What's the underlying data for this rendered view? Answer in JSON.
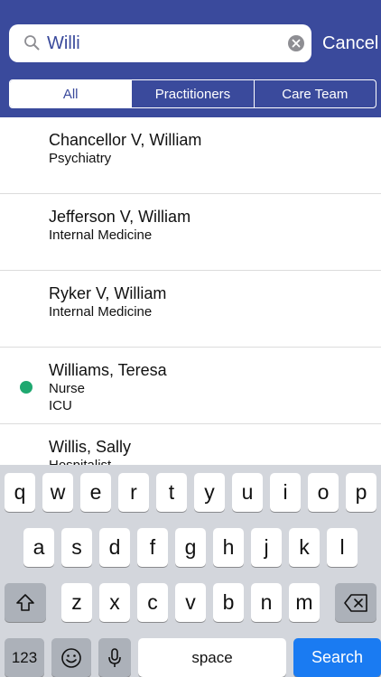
{
  "search": {
    "value": "Willi",
    "placeholder": ""
  },
  "header": {
    "cancel_label": "Cancel"
  },
  "segments": [
    {
      "label": "All",
      "active": true
    },
    {
      "label": "Practitioners",
      "active": false
    },
    {
      "label": "Care Team",
      "active": false
    }
  ],
  "results": [
    {
      "name": "Chancellor V, William",
      "lines": [
        "Psychiatry"
      ],
      "status": ""
    },
    {
      "name": "Jefferson V, William",
      "lines": [
        "Internal Medicine"
      ],
      "status": ""
    },
    {
      "name": "Ryker V, William",
      "lines": [
        "Internal Medicine"
      ],
      "status": ""
    },
    {
      "name": "Williams, Teresa",
      "lines": [
        "Nurse",
        "ICU"
      ],
      "status": "online"
    },
    {
      "name": "Willis, Sally",
      "lines": [
        "Hospitalist"
      ],
      "status": ""
    }
  ],
  "keyboard": {
    "row1": [
      "q",
      "w",
      "e",
      "r",
      "t",
      "y",
      "u",
      "i",
      "o",
      "p"
    ],
    "row2": [
      "a",
      "s",
      "d",
      "f",
      "g",
      "h",
      "j",
      "k",
      "l"
    ],
    "row3": [
      "z",
      "x",
      "c",
      "v",
      "b",
      "n",
      "m"
    ],
    "numbers_label": "123",
    "space_label": "space",
    "search_label": "Search"
  },
  "colors": {
    "header": "#3a4a9c",
    "status_online": "#1fa870",
    "search_key": "#1a7bf2"
  }
}
